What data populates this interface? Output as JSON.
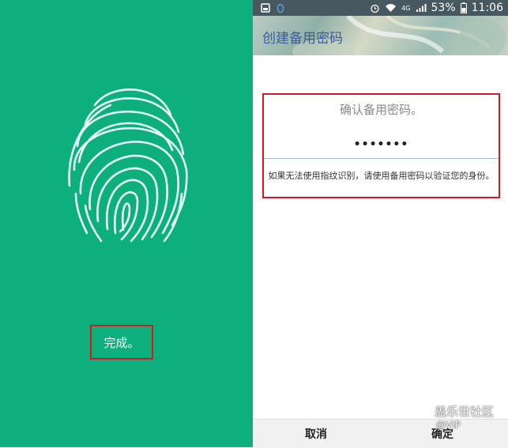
{
  "left_panel": {
    "done_label": "完成。"
  },
  "right_panel": {
    "status_bar": {
      "battery": "53%",
      "time": "11:06",
      "network": "4G"
    },
    "header": {
      "title": "创建备用密码"
    },
    "password_card": {
      "title": "确认备用密码。",
      "masked_value": "•••••••",
      "hint": "如果无法使用指纹识别，请使用备用密码以验证您的身份。"
    },
    "buttons": {
      "cancel": "取消",
      "ok": "确定"
    },
    "watermark": {
      "name": "盖乐世社区",
      "handle": "@VIP"
    }
  },
  "colors": {
    "left_background": "#0db07c",
    "highlight_border": "#d7191c",
    "header_title": "#3e5aa0"
  }
}
